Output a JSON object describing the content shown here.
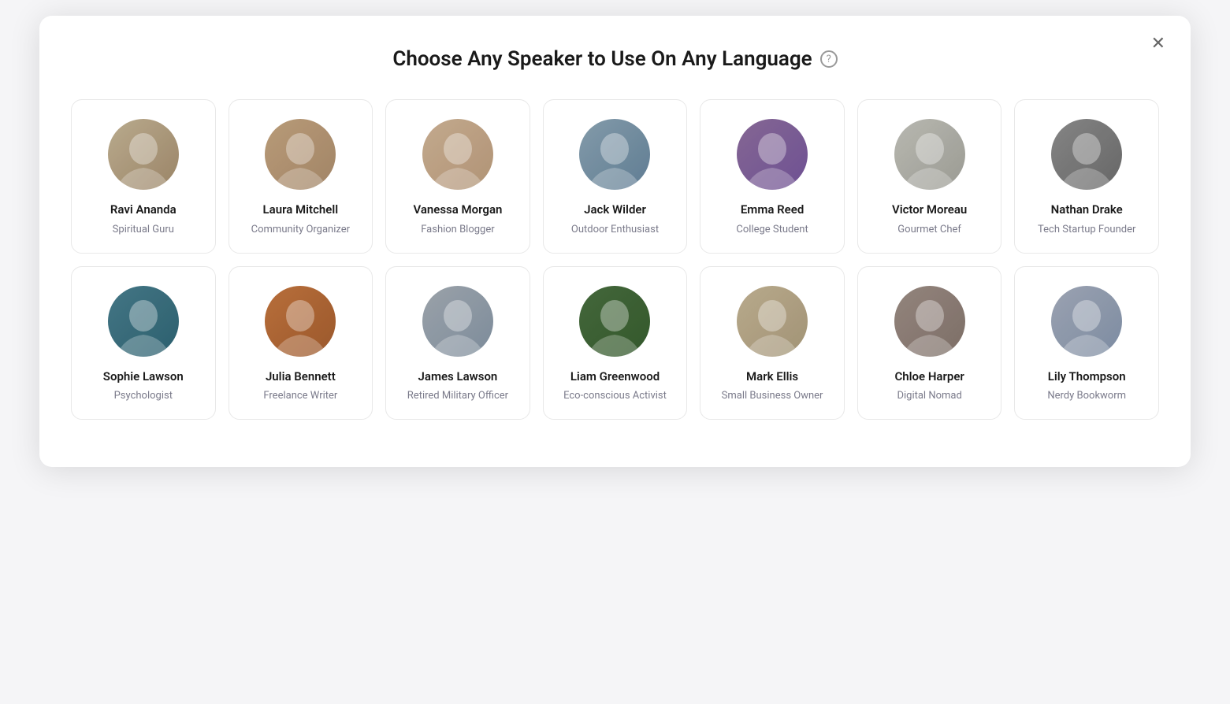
{
  "modal": {
    "title": "Choose Any Speaker to Use On Any Language",
    "help_label": "?",
    "close_label": "✕"
  },
  "speakers": [
    {
      "id": "ravi",
      "name": "Ravi Ananda",
      "role": "Spiritual Guru",
      "av_class": "av-ravi",
      "emoji": "🧔"
    },
    {
      "id": "laura",
      "name": "Laura Mitchell",
      "role": "Community Organizer",
      "av_class": "av-laura",
      "emoji": "👩"
    },
    {
      "id": "vanessa",
      "name": "Vanessa Morgan",
      "role": "Fashion Blogger",
      "av_class": "av-vanessa",
      "emoji": "👩"
    },
    {
      "id": "jack",
      "name": "Jack Wilder",
      "role": "Outdoor Enthusiast",
      "av_class": "av-jack",
      "emoji": "👨"
    },
    {
      "id": "emma",
      "name": "Emma Reed",
      "role": "College Student",
      "av_class": "av-emma",
      "emoji": "👩"
    },
    {
      "id": "victor",
      "name": "Victor Moreau",
      "role": "Gourmet Chef",
      "av_class": "av-victor",
      "emoji": "👨"
    },
    {
      "id": "nathan",
      "name": "Nathan Drake",
      "role": "Tech Startup Founder",
      "av_class": "av-nathan",
      "emoji": "👨"
    },
    {
      "id": "sophie",
      "name": "Sophie Lawson",
      "role": "Psychologist",
      "av_class": "av-sophie",
      "emoji": "👩"
    },
    {
      "id": "julia",
      "name": "Julia Bennett",
      "role": "Freelance Writer",
      "av_class": "av-julia",
      "emoji": "👩"
    },
    {
      "id": "james",
      "name": "James Lawson",
      "role": "Retired Military Officer",
      "av_class": "av-james",
      "emoji": "👨"
    },
    {
      "id": "liam",
      "name": "Liam Greenwood",
      "role": "Eco-conscious Activist",
      "av_class": "av-liam",
      "emoji": "👨"
    },
    {
      "id": "mark",
      "name": "Mark Ellis",
      "role": "Small Business Owner",
      "av_class": "av-mark",
      "emoji": "👨"
    },
    {
      "id": "chloe",
      "name": "Chloe Harper",
      "role": "Digital Nomad",
      "av_class": "av-chloe",
      "emoji": "👩"
    },
    {
      "id": "lily",
      "name": "Lily Thompson",
      "role": "Nerdy Bookworm",
      "av_class": "av-lily",
      "emoji": "👩"
    }
  ]
}
